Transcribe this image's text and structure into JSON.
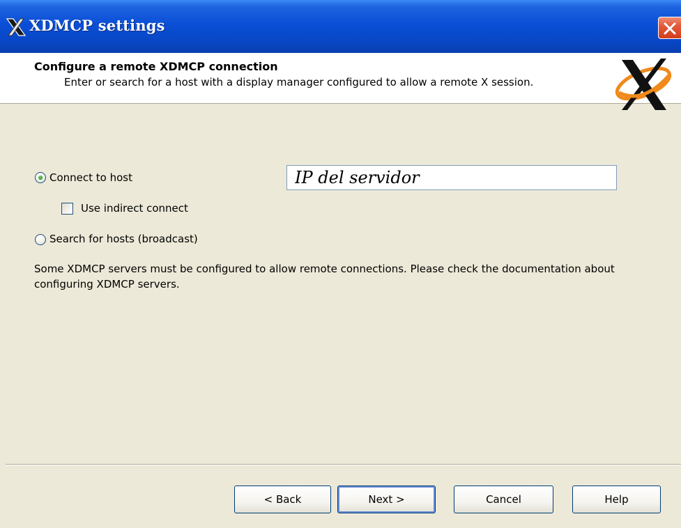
{
  "window": {
    "title": "XDMCP settings"
  },
  "header": {
    "title": "Configure a remote XDMCP connection",
    "description": "Enter or search for a host with a display manager configured to allow a remote X session."
  },
  "options": {
    "connect_to_host": {
      "label": "Connect to host",
      "selected": true
    },
    "use_indirect": {
      "label": "Use indirect connect",
      "checked": false
    },
    "search_broadcast": {
      "label": "Search for hosts (broadcast)",
      "selected": false
    }
  },
  "host_input": {
    "value": "IP del servidor"
  },
  "info": {
    "text": "Some XDMCP servers must be configured to allow remote connections. Please check the documentation about configuring XDMCP servers."
  },
  "buttons": {
    "back": "< Back",
    "next": "Next >",
    "cancel": "Cancel",
    "help": "Help"
  },
  "colors": {
    "titlebar": "#0a4fd6",
    "dialog_bg": "#ece9d8",
    "close_button": "#d33d1c",
    "logo_orange": "#f08a1c"
  },
  "icons": {
    "title_icon": "x-window-system-icon",
    "close": "close-icon",
    "header_logo": "x-logo-icon"
  }
}
